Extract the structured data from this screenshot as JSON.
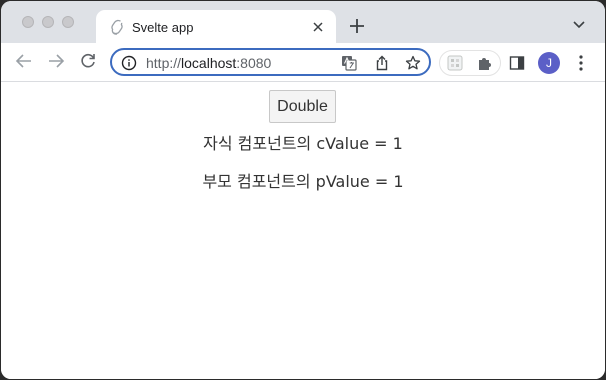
{
  "browser": {
    "tab_title": "Svelte app",
    "url_prefix": "http://",
    "url_host": "localhost",
    "url_port": ":8080",
    "profile_initial": "J"
  },
  "page": {
    "button_label": "Double",
    "child_line": "자식 컴포넌트의 cValue = 1",
    "parent_line": "부모 컴포넌트의 pValue = 1"
  },
  "colors": {
    "tabstrip_bg": "#dee1e6",
    "omnibox_border": "#3c6bbf",
    "avatar_bg": "#5b5fc7"
  }
}
